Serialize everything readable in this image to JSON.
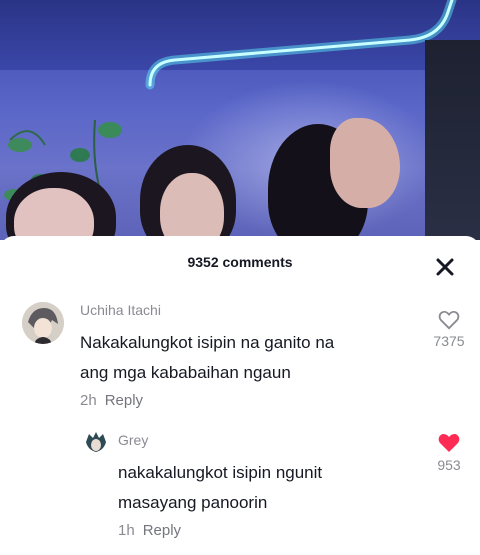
{
  "sheet": {
    "title": "9352 comments",
    "close_icon": "close-icon"
  },
  "comments": [
    {
      "username": "Uchiha Itachi",
      "lines": [
        "Nakakalungkot isipin na ganito na",
        "ang mga kababaihan ngaun"
      ],
      "time": "2h",
      "reply_label": "Reply",
      "likes": "7375",
      "liked": false,
      "like_color": "#8a8b91"
    },
    {
      "username": "Grey",
      "lines": [
        "nakakalungkot isipin ngunit",
        "masayang panoorin"
      ],
      "time": "1h",
      "reply_label": "Reply",
      "likes": "953",
      "liked": true,
      "like_color": "#fe2c55"
    }
  ]
}
